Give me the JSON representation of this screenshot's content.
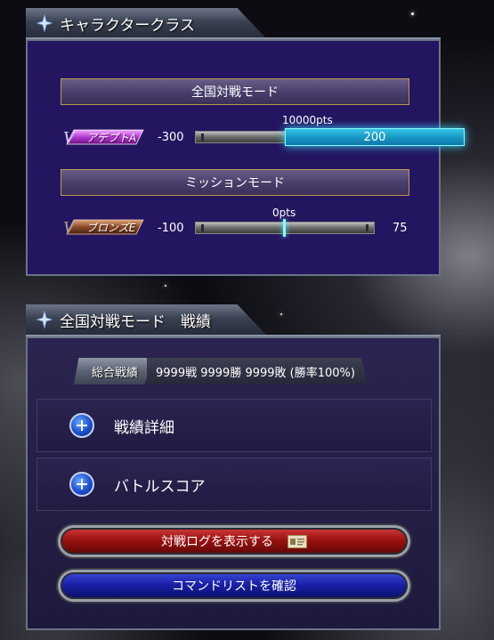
{
  "colors": {
    "panel_purple": "#241560",
    "accent_cyan": "#37d7ff",
    "gold_border": "#b89b4e",
    "red_button": "#9b1212",
    "blue_button": "#1a20a8"
  },
  "character_class": {
    "title": "キャラクタークラス",
    "national_mode": {
      "label": "全国対戦モード",
      "rank_badge": "アデプトA",
      "rank_min": "-300",
      "points": "10000pts",
      "rank_max": "200",
      "progress": 0.5
    },
    "mission_mode": {
      "label": "ミッションモード",
      "rank_badge": "ブロンズE",
      "rank_min": "-100",
      "points": "0pts",
      "rank_max": "75",
      "progress": 0.57
    }
  },
  "battle_record": {
    "title": "全国対戦モード　戦績",
    "summary_label": "総合戦績",
    "summary_value": "9999戦 9999勝 9999敗 (勝率100%)",
    "sections": [
      {
        "label": "戦績詳細",
        "icon": "plus-icon"
      },
      {
        "label": "バトルスコア",
        "icon": "plus-icon"
      }
    ],
    "buttons": {
      "battle_log": "対戦ログを表示する",
      "command_list": "コマンドリストを確認"
    }
  }
}
